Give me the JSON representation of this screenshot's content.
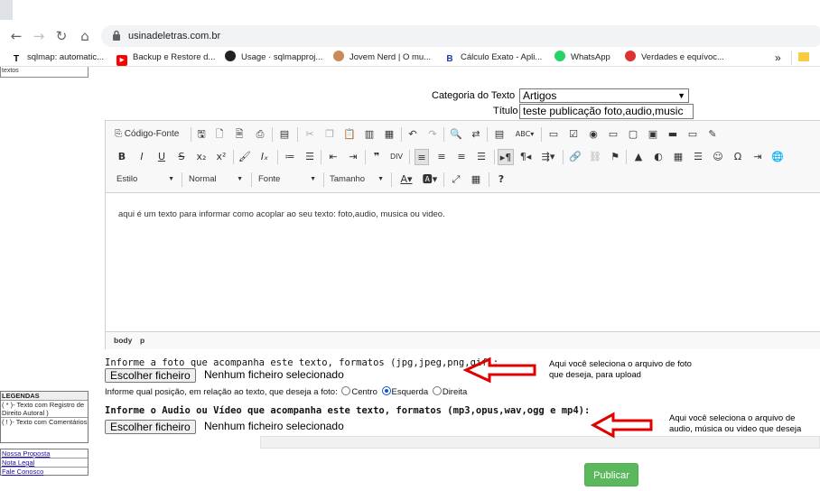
{
  "browser": {
    "url": "usinadeletras.com.br",
    "nav": {
      "back": "←",
      "forward": "→",
      "reload": "↻",
      "home": "⌂"
    },
    "bookmarks": [
      {
        "label": "sqlmap: automatic...",
        "icon": "T"
      },
      {
        "label": "Backup e Restore d...",
        "icon": "youtube-icon"
      },
      {
        "label": "Usage · sqlmapproj...",
        "icon": "github-icon"
      },
      {
        "label": "Jovem Nerd | O mu...",
        "icon": "jovemnerd-icon"
      },
      {
        "label": "Cálculo Exato - Apli...",
        "icon": "B"
      },
      {
        "label": "WhatsApp",
        "icon": "whatsapp-icon"
      },
      {
        "label": "Verdades e equívoc...",
        "icon": "site-icon"
      }
    ],
    "more": "»"
  },
  "sidebar": {
    "top_box": "textos",
    "legend": {
      "header": "LEGENDAS",
      "items": [
        "( * )- Texto com Registro de Direito Autoral )",
        "( ! )- Texto com Comentários"
      ]
    },
    "links": [
      "Nossa Proposta",
      "Nota Legal",
      "Fale Conosco"
    ]
  },
  "form": {
    "categoria_label": "Categoria do Texto",
    "categoria_value": "Artigos",
    "titulo_label": "Título",
    "titulo_value": "teste publicação foto,audio,music"
  },
  "editor": {
    "toolbar": {
      "source_label": "Código-Fonte",
      "styles_label": "Estilo",
      "format_label": "Normal",
      "font_label": "Fonte",
      "size_label": "Tamanho"
    },
    "content": "aqui é um texto para informar como acoplar ao seu texto: foto,audio, musica ou video.",
    "path": [
      "body",
      "p"
    ]
  },
  "foto": {
    "label": "Informe a foto que acompanha este texto, formatos (jpg,jpeg,png,gif):",
    "button": "Escolher ficheiro",
    "no_file": "Nenhum ficheiro selecionado",
    "position_label": "Informe qual posição, em relação ao texto, que deseja a foto:",
    "options": [
      {
        "label": "Centro",
        "checked": false
      },
      {
        "label": "Esquerda",
        "checked": true
      },
      {
        "label": "Direita",
        "checked": false
      }
    ]
  },
  "audio": {
    "label": "Informe o Audio ou Vídeo que acompanha este texto, formatos (mp3,opus,wav,ogg e mp4):",
    "button": "Escolher ficheiro",
    "no_file": "Nenhum ficheiro selecionado"
  },
  "annotations": {
    "foto_note": "Aqui você seleciona o arquivo de foto que deseja, para upload",
    "audio_note": "Aqui você seleciona o arquivo de audio, música ou video que deseja",
    "arrow_color": "#e00000"
  },
  "publicar": "Publicar",
  "colors": {
    "publish": "#5cb85c"
  }
}
